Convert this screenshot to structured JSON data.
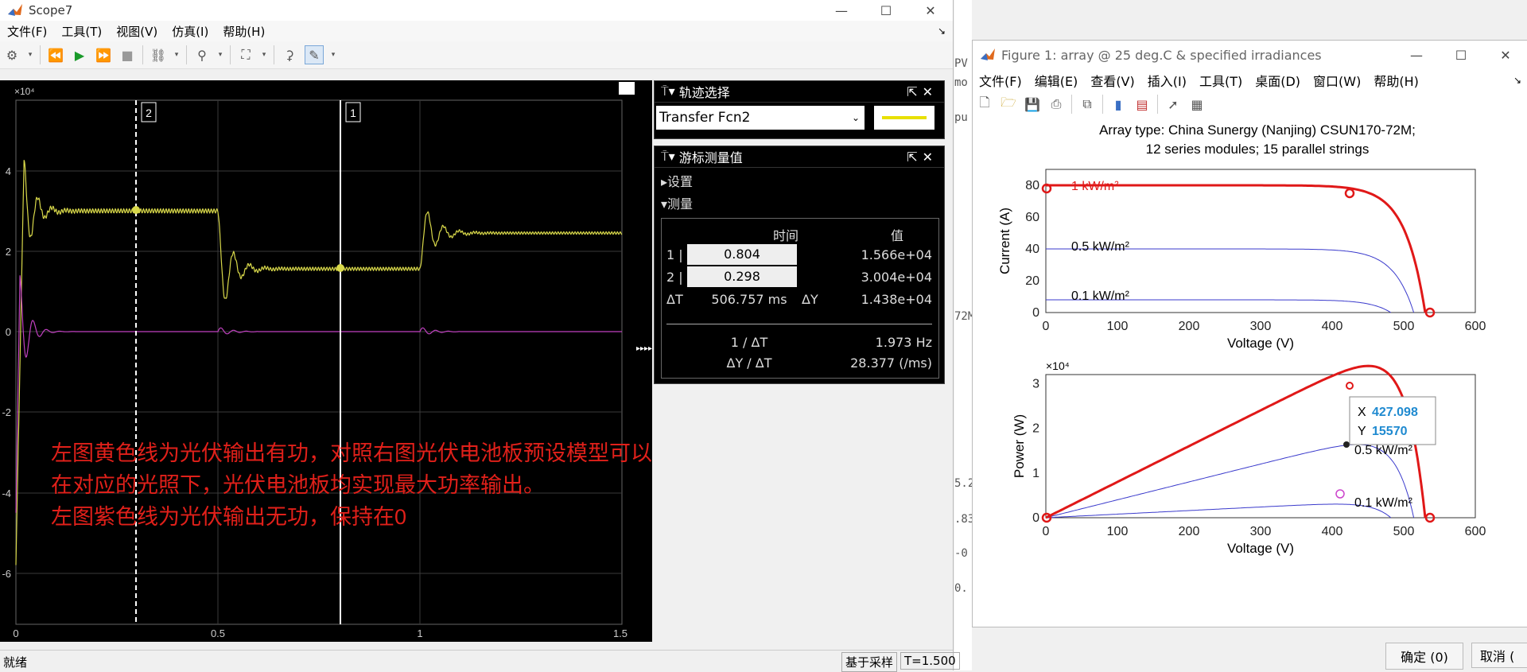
{
  "scope": {
    "title": "Scope7",
    "menu": [
      "文件(F)",
      "工具(T)",
      "视图(V)",
      "仿真(I)",
      "帮助(H)"
    ],
    "exponent": "×10⁴",
    "y_ticks": [
      "4",
      "2",
      "0",
      "-2",
      "-4",
      "-6"
    ],
    "x_ticks": [
      "0",
      "0.5",
      "1",
      "1.5"
    ],
    "cursor_labels": [
      "2",
      "1"
    ],
    "annotation": [
      "左图黄色线为光伏输出有功，对照右图光伏电池板预设模型可以看出，",
      "在对应的光照下，光伏电池板均实现最大功率输出。",
      "左图紫色线为光伏输出无功，保持在0"
    ],
    "colors": {
      "yellow": "#d8d84a",
      "magenta": "#c040c0",
      "annotation": "#e0201a"
    }
  },
  "trace_panel": {
    "title": "轨迹选择",
    "selected": "Transfer Fcn2",
    "swatch_color": "#e8e000"
  },
  "cursor_panel": {
    "title": "游标测量值",
    "settings": "设置",
    "measure": "测量",
    "col_time": "时间",
    "col_value": "值",
    "rows": [
      {
        "label": "1 |",
        "time": "0.804",
        "value": "1.566e+04"
      },
      {
        "label": "2 |",
        "time": "0.298",
        "value": "3.004e+04"
      }
    ],
    "dT_label": "ΔT",
    "dT_value": "506.757 ms",
    "dY_label": "ΔY",
    "dY_value": "1.438e+04",
    "inv_label": "1 / ΔT",
    "inv_value": "1.973 Hz",
    "rate_label": "ΔY / ΔT",
    "rate_value": "28.377 (/ms)"
  },
  "status": {
    "left": "就绪",
    "mode": "基于采样",
    "time": "T=1.500"
  },
  "figure": {
    "title": "Figure 1: array @ 25 deg.C & specified irradiances",
    "menu": [
      "文件(F)",
      "编辑(E)",
      "查看(V)",
      "插入(I)",
      "工具(T)",
      "桌面(D)",
      "窗口(W)",
      "帮助(H)"
    ],
    "plot_title_1": "Array type: China Sunergy (Nanjing) CSUN170-72M;",
    "plot_title_2": "12 series modules; 15 parallel strings",
    "iv_ylabel": "Current (A)",
    "pv_ylabel": "Power (W)",
    "xlabel": "Voltage (V)",
    "x_ticks": [
      "0",
      "100",
      "200",
      "300",
      "400",
      "500",
      "600"
    ],
    "iv_y_ticks": [
      "0",
      "20",
      "40",
      "60",
      "80"
    ],
    "pv_y_ticks": [
      "0",
      "1",
      "2",
      "3"
    ],
    "pv_exponent": "×10⁴",
    "curve_labels": [
      "1 kW/m²",
      "0.5 kW/m²",
      "0.1 kW/m²"
    ],
    "datatip_x_label": "X",
    "datatip_x": "427.098",
    "datatip_y_label": "Y",
    "datatip_y": "15570"
  },
  "dialog_buttons": {
    "ok": "确定 (0)",
    "cancel": "取消 ("
  },
  "background_fragments": [
    "PV",
    "mo",
    "pu",
    "72M",
    "5.2",
    ".83",
    "-0",
    "0."
  ]
}
